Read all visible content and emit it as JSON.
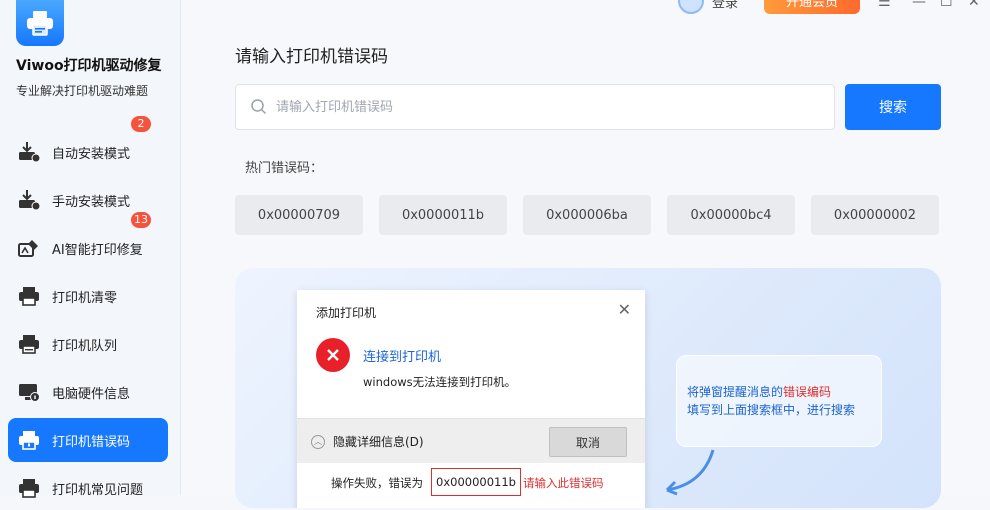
{
  "app": {
    "name": "Viwoo打印机驱动修复",
    "subtitle": "专业解决打印机驱动难题"
  },
  "topbar": {
    "login_label": "登录",
    "vip_label": "开通会员"
  },
  "sidebar": {
    "items": [
      {
        "label": "自动安装模式",
        "badge": "2",
        "icon": "auto-install-icon"
      },
      {
        "label": "手动安装模式",
        "badge": "",
        "icon": "manual-install-icon"
      },
      {
        "label": "AI智能打印修复",
        "badge": "13",
        "icon": "ai-repair-icon"
      },
      {
        "label": "打印机清零",
        "badge": "",
        "icon": "printer-reset-icon"
      },
      {
        "label": "打印机队列",
        "badge": "",
        "icon": "printer-queue-icon"
      },
      {
        "label": "电脑硬件信息",
        "badge": "",
        "icon": "hardware-info-icon"
      },
      {
        "label": "打印机错误码",
        "badge": "",
        "icon": "error-code-icon",
        "active": true
      },
      {
        "label": "打印机常见问题",
        "badge": "",
        "icon": "faq-icon"
      }
    ]
  },
  "main": {
    "title": "请输入打印机错误码",
    "search": {
      "placeholder": "请输入打印机错误码",
      "value": "",
      "button_label": "搜索"
    },
    "hot_label": "热门错误码：",
    "hot_codes": [
      "0x00000709",
      "0x0000011b",
      "0x000006ba",
      "0x00000bc4",
      "0x00000002"
    ]
  },
  "illustration": {
    "dialog_title": "添加打印机",
    "heading": "连接到打印机",
    "message": "windows无法连接到打印机。",
    "hide_details": "隐藏详细信息(D)",
    "cancel_label": "取消",
    "fail_prefix": "操作失败，错误为",
    "fail_code": "0x00000011b",
    "fail_hint": "请输入此错误码",
    "tip_line1_prefix": "将弹窗提醒消息的",
    "tip_line1_highlight": "错误编码",
    "tip_line2": "填写到上面搜索框中，进行搜索"
  },
  "colors": {
    "accent": "#1677ff",
    "badge": "#f5533d",
    "error": "#e02e2e",
    "vip": "#ff7a2c"
  }
}
